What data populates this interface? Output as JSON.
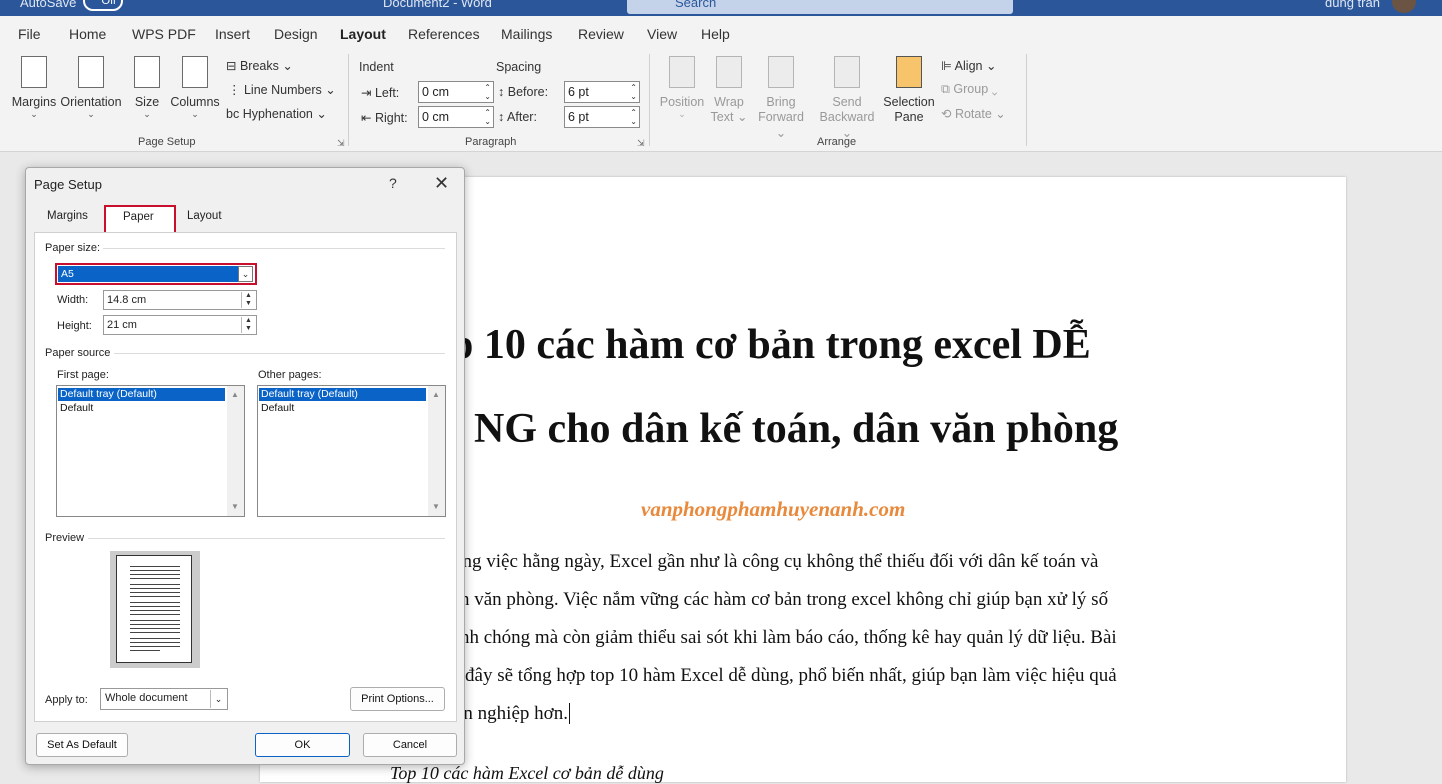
{
  "titlebar": {
    "autosave": "AutoSave",
    "toggle": "Off",
    "doc": "Document2 - Word",
    "search": "Search",
    "user": "dung tran"
  },
  "menu": [
    "File",
    "Home",
    "WPS PDF",
    "Insert",
    "Design",
    "Layout",
    "References",
    "Mailings",
    "Review",
    "View",
    "Help"
  ],
  "active_tab": "Layout",
  "ribbon": {
    "page_setup": {
      "margins": "Margins",
      "orientation": "Orientation",
      "size": "Size",
      "columns": "Columns",
      "breaks": "Breaks",
      "line_numbers": "Line Numbers",
      "hyphenation": "Hyphenation",
      "group": "Page Setup"
    },
    "paragraph": {
      "indent": "Indent",
      "spacing": "Spacing",
      "left": "Left:",
      "right": "Right:",
      "before": "Before:",
      "after": "After:",
      "left_val": "0 cm",
      "right_val": "0 cm",
      "before_val": "6 pt",
      "after_val": "6 pt",
      "group": "Paragraph"
    },
    "arrange": {
      "position": "Position",
      "wrap1": "Wrap",
      "wrap2": "Text",
      "bring1": "Bring",
      "bring2": "Forward",
      "send1": "Send",
      "send2": "Backward",
      "sel1": "Selection",
      "sel2": "Pane",
      "align": "Align",
      "group_btn": "Group",
      "rotate": "Rotate",
      "group": "Arrange"
    }
  },
  "document": {
    "title_line1": "p 10 các hàm cơ bản trong excel DỄ",
    "title_line2": "NG cho dân kế toán, dân văn phòng",
    "site": "vanphongphamhuyenanh.com",
    "lines": [
      "ông việc hằng ngày, Excel gần như là công cụ không thể thiếu đối với dân kế toán và",
      "n văn phòng. Việc nắm vững các hàm cơ bản trong excel không chỉ giúp bạn xử lý số",
      "nh chóng mà còn giảm thiểu sai sót khi làm báo cáo, thống kê hay quản lý dữ liệu. Bài",
      "i đây sẽ tổng hợp top 10 hàm Excel dễ dùng, phổ biến nhất, giúp bạn làm việc hiệu quả",
      "ên nghiệp hơn."
    ],
    "caption": "Top 10 các hàm Excel cơ bản dễ dùng"
  },
  "dialog": {
    "title": "Page Setup",
    "help": "?",
    "close": "✕",
    "tabs": [
      "Margins",
      "Paper",
      "Layout"
    ],
    "paper_size_label": "Paper size:",
    "paper_size": "A5",
    "width_label": "Width:",
    "width": "14.8 cm",
    "height_label": "Height:",
    "height": "21 cm",
    "paper_source": "Paper source",
    "first_page": "First page:",
    "other_pages": "Other pages:",
    "tray_items": [
      "Default tray (Default)",
      "Default"
    ],
    "preview": "Preview",
    "apply_to": "Apply to:",
    "apply_value": "Whole document",
    "print_options": "Print Options...",
    "set_default": "Set As Default",
    "ok": "OK",
    "cancel": "Cancel"
  }
}
